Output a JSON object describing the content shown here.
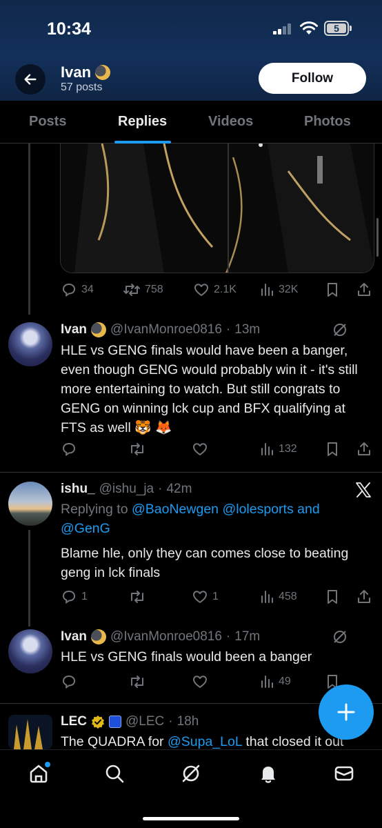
{
  "status_bar": {
    "time": "10:34",
    "battery": "5"
  },
  "profile": {
    "name": "Ivan",
    "posts": "57 posts",
    "follow_label": "Follow"
  },
  "tabs": [
    {
      "label": "Posts",
      "active": false
    },
    {
      "label": "Replies",
      "active": true
    },
    {
      "label": "Videos",
      "active": false
    },
    {
      "label": "Photos",
      "active": false
    }
  ],
  "first_post_stats": {
    "replies": "34",
    "reposts": "758",
    "likes": "2.1K",
    "views": "32K"
  },
  "posts": [
    {
      "name": "Ivan",
      "handle": "@IvanMonroe0816",
      "time": "13m",
      "text": "HLE vs GENG finals would have been a banger, even though GENG would probably win it - it's still more entertaining to watch. But still congrats to GENG on winning lck cup and BFX qualifying at FTS as well 🐯 🦊",
      "views": "132"
    },
    {
      "name": "ishu_",
      "handle": "@ishu_ja",
      "time": "42m",
      "reply_prefix": "Replying to",
      "reply_to_1": "@BaoNewgen",
      "reply_to_2": "@lolesports",
      "reply_and": "and",
      "reply_to_3": "@GenG",
      "text": "Blame hle, only they can comes close to beating geng in lck finals",
      "replies": "1",
      "likes": "1",
      "views": "458"
    },
    {
      "name": "Ivan",
      "handle": "@IvanMonroe0816",
      "time": "17m",
      "text": "HLE vs GENG finals would been a banger",
      "views": "49"
    },
    {
      "name": "LEC",
      "handle": "@LEC",
      "time": "18h",
      "text_prefix": "The QUADRA for",
      "text_mention": "@Supa_LoL",
      "text_suffix": "that closed it out"
    }
  ],
  "colors": {
    "accent": "#1d9bf0",
    "background": "#000000",
    "muted": "#71767b"
  },
  "icons": [
    "back-arrow-icon",
    "reply-icon",
    "repost-icon",
    "like-icon",
    "views-icon",
    "bookmark-icon",
    "share-icon",
    "grok-icon",
    "x-logo-icon",
    "verified-icon",
    "plus-icon",
    "home-icon",
    "search-icon",
    "notifications-icon",
    "messages-icon"
  ]
}
